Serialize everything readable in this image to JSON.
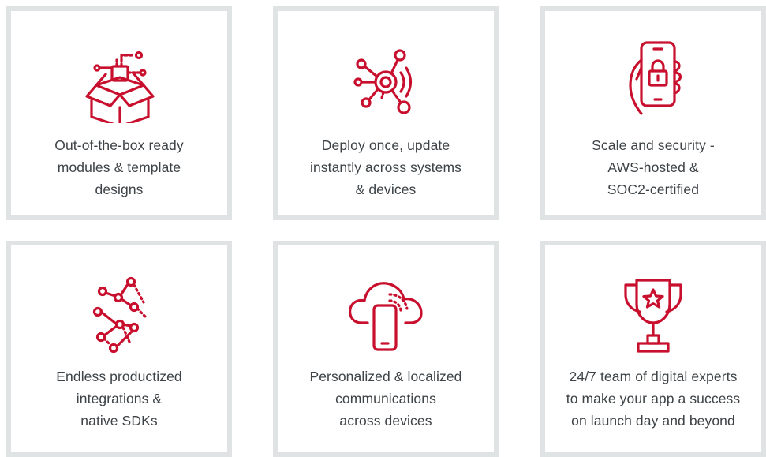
{
  "accent_color": "#c8102e",
  "card_border_color": "#dfe3e4",
  "text_color": "#3d4347",
  "cards": [
    {
      "icon": "box-icon",
      "lines": [
        "Out-of-the-box ready",
        "modules & template",
        "designs"
      ]
    },
    {
      "icon": "broadcast-hub-icon",
      "lines": [
        "Deploy once, update",
        "instantly across systems",
        "& devices"
      ]
    },
    {
      "icon": "phone-lock-icon",
      "lines": [
        "Scale and security -",
        "AWS-hosted &",
        "SOC2-certified"
      ]
    },
    {
      "icon": "integration-network-icon",
      "lines": [
        "Endless productized",
        "integrations &",
        "native SDKs"
      ]
    },
    {
      "icon": "cloud-phone-icon",
      "lines": [
        "Personalized & localized",
        "communications",
        "across devices"
      ]
    },
    {
      "icon": "trophy-icon",
      "lines": [
        "24/7 team of digital experts",
        "to make your app a success",
        "on launch day and beyond"
      ]
    }
  ]
}
